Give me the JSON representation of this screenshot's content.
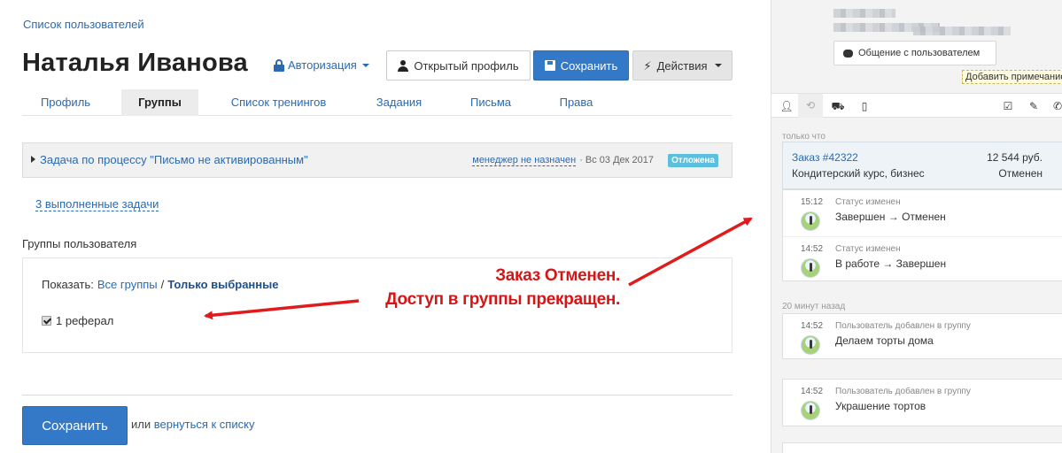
{
  "main": {
    "breadcrumb": "Список пользователей",
    "title": "Наталья Иванова",
    "auth_dropdown": "Авторизация",
    "buttons": {
      "open_profile": "Открытый профиль",
      "save": "Сохранить",
      "actions": "Действия"
    },
    "tabs": [
      {
        "label": "Профиль",
        "active": false
      },
      {
        "label": "Группы",
        "active": true
      },
      {
        "label": "Список тренингов",
        "active": false
      },
      {
        "label": "Задания",
        "active": false
      },
      {
        "label": "Письма",
        "active": false
      },
      {
        "label": "Права",
        "active": false
      }
    ],
    "task": {
      "title": "Задача по процессу \"Письмо не активированным\"",
      "manager": "менеджер не назначен",
      "date": "· Вс 03 Дек 2017",
      "badge": "Отложена"
    },
    "done_tasks": "3 выполненные задачи",
    "groups_label": "Группы пользователя",
    "show_label": "Показать:",
    "show_all": "Все группы",
    "show_sep": "/",
    "show_selected": "Только выбранные",
    "group_items": [
      {
        "label": "1 реферал",
        "checked": true
      }
    ],
    "save_bottom": "Сохранить",
    "or_text": "или",
    "return_link": "вернуться к списку"
  },
  "annotation": {
    "line1": "Заказ Отменен.",
    "line2": "Доступ в группы прекращен.",
    "color": "#d61616"
  },
  "sidebar": {
    "communication_button": "Общение с пользователем",
    "add_note_tip": "Добавить примечание",
    "sections": [
      {
        "label": "только что"
      },
      {
        "label": "20 минут назад"
      }
    ],
    "order": {
      "link": "Заказ #42322",
      "desc": "Кондитерский курс, бизнес",
      "price": "12 544 руб.",
      "status": "Отменен"
    },
    "order_events": [
      {
        "time": "15:12",
        "title": "Статус изменен",
        "text": "Завершен → Отменен"
      },
      {
        "time": "14:52",
        "title": "Статус изменен",
        "text": "В работе → Завершен"
      }
    ],
    "group_events": [
      {
        "time": "14:52",
        "title": "Пользователь добавлен в группу",
        "text": "Делаем торты дома"
      },
      {
        "time": "14:52",
        "title": "Пользователь добавлен в группу",
        "text": "Украшение тортов"
      }
    ]
  },
  "colors": {
    "link": "#2a6ab1",
    "primary": "#3479c8",
    "badge": "#5bc0de"
  }
}
